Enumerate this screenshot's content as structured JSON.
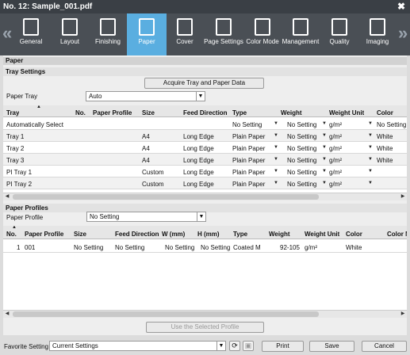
{
  "window": {
    "title": "No. 12: Sample_001.pdf",
    "close_glyph": "✖"
  },
  "toolbar": {
    "left_arrow": "«",
    "right_arrow": "»",
    "items": [
      {
        "label": "General",
        "icon": "general-icon"
      },
      {
        "label": "Layout",
        "icon": "layout-icon"
      },
      {
        "label": "Finishing",
        "icon": "finishing-icon"
      },
      {
        "label": "Paper",
        "icon": "paper-icon",
        "active": true
      },
      {
        "label": "Cover",
        "icon": "cover-icon"
      },
      {
        "label": "Page Settings",
        "icon": "page-settings-icon"
      },
      {
        "label": "Color Mode",
        "icon": "color-mode-icon"
      },
      {
        "label": "Management",
        "icon": "management-icon"
      },
      {
        "label": "Quality",
        "icon": "quality-icon"
      },
      {
        "label": "Imaging",
        "icon": "imaging-icon"
      }
    ]
  },
  "paper": {
    "section_title": "Paper",
    "tray_settings": {
      "title": "Tray Settings",
      "acquire_button": "Acquire Tray and Paper Data",
      "paper_tray_label": "Paper Tray",
      "paper_tray_value": "Auto",
      "columns": [
        "Tray",
        "No.",
        "Paper Profile",
        "Size",
        "Feed Direction",
        "Type",
        "Weight",
        "Weight Unit",
        "Color"
      ],
      "rows": [
        [
          "Automatically Select",
          "",
          "",
          "",
          "",
          "No Setting",
          "No Setting",
          "g/m²",
          "No Setting"
        ],
        [
          "Tray 1",
          "",
          "",
          "A4",
          "Long Edge",
          "Plain Paper",
          "No Setting",
          "g/m²",
          "White"
        ],
        [
          "Tray 2",
          "",
          "",
          "A4",
          "Long Edge",
          "Plain Paper",
          "No Setting",
          "g/m²",
          "White"
        ],
        [
          "Tray 3",
          "",
          "",
          "A4",
          "Long Edge",
          "Plain Paper",
          "No Setting",
          "g/m²",
          "White"
        ],
        [
          "PI Tray 1",
          "",
          "",
          "Custom",
          "Long Edge",
          "Plain Paper",
          "No Setting",
          "g/m²",
          ""
        ],
        [
          "PI Tray 2",
          "",
          "",
          "Custom",
          "Long Edge",
          "Plain Paper",
          "No Setting",
          "g/m²",
          ""
        ]
      ]
    },
    "paper_profiles": {
      "title": "Paper Profiles",
      "profile_label": "Paper Profile",
      "profile_value": "No Setting",
      "columns": [
        "No.",
        "Paper Profile",
        "Size",
        "Feed Direction",
        "W (mm)",
        "H (mm)",
        "Type",
        "Weight",
        "Weight Unit",
        "Color",
        "Color M"
      ],
      "rows": [
        [
          "1",
          "001",
          "No Setting",
          "No Setting",
          "No Setting",
          "No Setting",
          "Coated M",
          "92-105",
          "g/m²",
          "White",
          ""
        ]
      ],
      "use_button": "Use the Selected Profile"
    }
  },
  "footer": {
    "favorite_label": "Favorite Setting",
    "favorite_value": "Current Settings",
    "print_button": "Print",
    "save_button": "Save",
    "cancel_button": "Cancel"
  }
}
